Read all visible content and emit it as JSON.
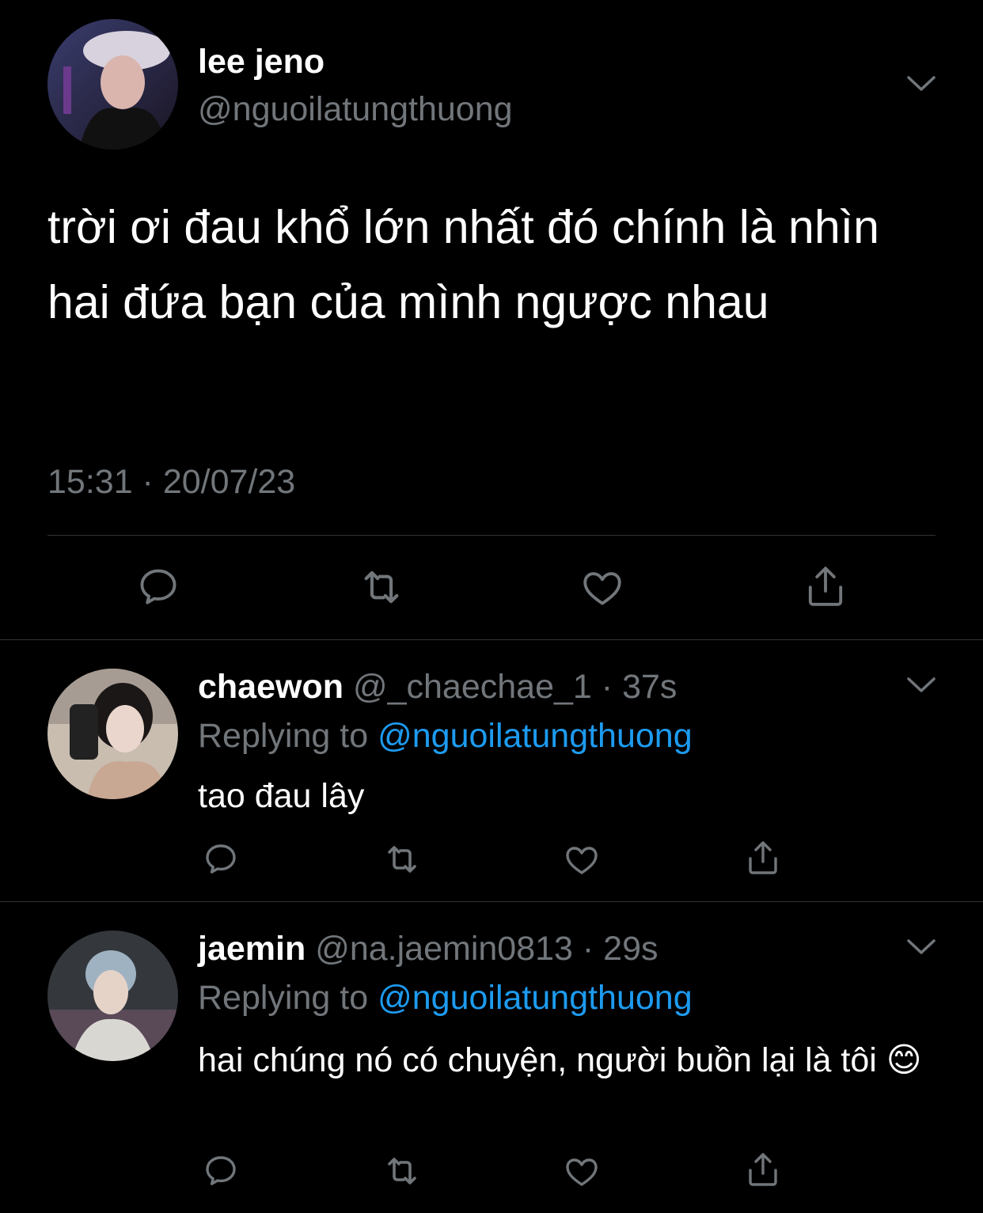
{
  "main_tweet": {
    "display_name": "lee jeno",
    "handle": "@nguoilatungthuong",
    "text": "trời ơi đau khổ lớn nhất đó chính là nhìn hai đứa bạn của mình ngược nhau",
    "timestamp": "15:31 · 20/07/23"
  },
  "replies": [
    {
      "display_name": "chaewon",
      "handle": "@_chaechae_1",
      "time": "37s",
      "replying_label": "Replying to",
      "replying_to": "@nguoilatungthuong",
      "text": "tao đau lây"
    },
    {
      "display_name": "jaemin",
      "handle": "@na.jaemin0813",
      "time": "29s",
      "replying_label": "Replying to",
      "replying_to": "@nguoilatungthuong",
      "text": "hai chúng nó có chuyện, người buồn lại là tôi 😊"
    }
  ],
  "icons": [
    "reply-icon",
    "retweet-icon",
    "like-icon",
    "share-icon",
    "chevron-down-icon"
  ],
  "colors": {
    "background": "#000000",
    "text": "#ffffff",
    "muted": "#71767b",
    "link": "#1d9bf0",
    "divider": "#2f3336"
  }
}
